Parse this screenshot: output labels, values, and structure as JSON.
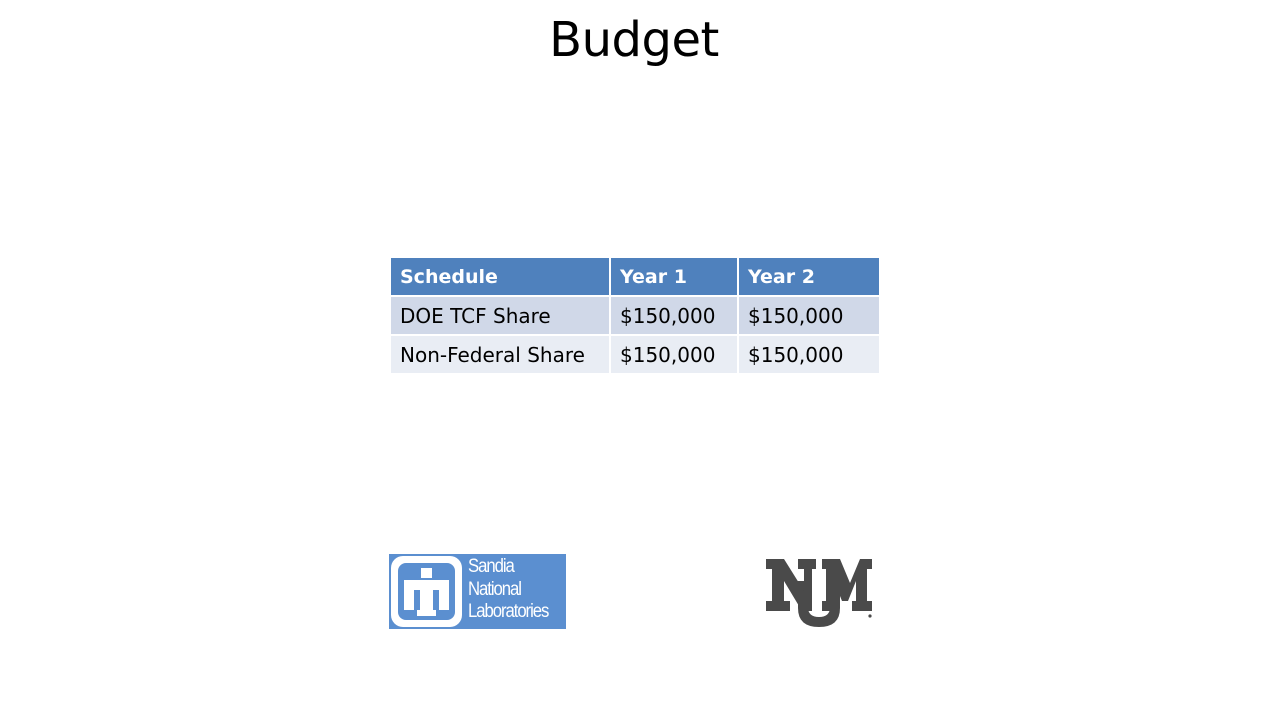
{
  "slide": {
    "title": "Budget"
  },
  "table": {
    "headers": [
      "Schedule",
      "Year 1",
      "Year 2"
    ],
    "rows": [
      [
        "DOE TCF Share",
        "$150,000",
        "$150,000"
      ],
      [
        "Non-Federal Share",
        "$150,000",
        "$150,000"
      ]
    ]
  },
  "logos": {
    "sandia": {
      "lines": [
        "Sandia",
        "National",
        "Laboratories"
      ],
      "color": "#5b8fd0"
    },
    "unm": {
      "mark": "NM",
      "color": "#4a4a4a"
    }
  },
  "colors": {
    "header": "#4f81bd",
    "row_odd": "#d0d8e8",
    "row_even": "#e9edf4"
  }
}
